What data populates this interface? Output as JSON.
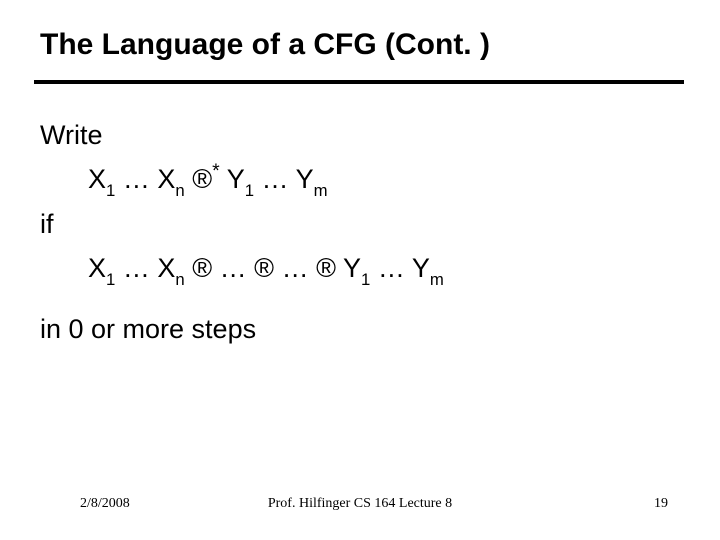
{
  "title": "The Language of a CFG (Cont. )",
  "body": {
    "write": "Write",
    "if": "if",
    "in_steps": "in 0 or more steps",
    "sym": {
      "X": "X",
      "Y": "Y",
      "one": "1",
      "n": "n",
      "m": "m",
      "ell": "…",
      "arrow": "®",
      "star": "*"
    }
  },
  "footer": {
    "date": "2/8/2008",
    "center": "Prof. Hilfinger CS 164 Lecture 8",
    "page": "19"
  }
}
